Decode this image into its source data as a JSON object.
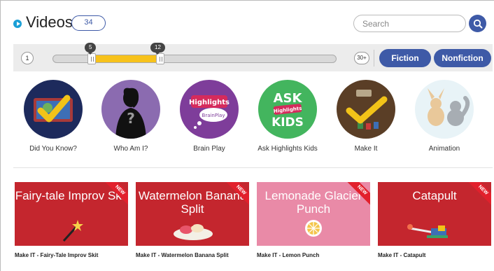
{
  "header": {
    "title": "Videos",
    "count": "34",
    "play_icon": "play-circle-icon"
  },
  "search": {
    "placeholder": "Search",
    "button_icon": "search-icon"
  },
  "filters": {
    "age_min_label": "1",
    "age_max_label": "30+",
    "range_low": "5",
    "range_high": "12",
    "fiction_label": "Fiction",
    "nonfiction_label": "Nonfiction"
  },
  "categories": [
    {
      "label": "Did You Know?",
      "icon": "checkmark-globe-icon"
    },
    {
      "label": "Who Am I?",
      "icon": "silhouette-question-icon"
    },
    {
      "label": "Brain Play",
      "icon": "highlights-brainplay-logo"
    },
    {
      "label": "Ask Highlights Kids",
      "icon": "ask-highlights-kids-logo",
      "logo_text": "ASK",
      "logo_sub": "KIDS",
      "logo_badge": "Highlights"
    },
    {
      "label": "Make It",
      "icon": "craft-checkmark-icon"
    },
    {
      "label": "Animation",
      "icon": "animated-animals-icon"
    }
  ],
  "brainplay_logo": {
    "brand": "Highlights",
    "sub": "BrainPlay"
  },
  "videos": [
    {
      "thumb_title": "Fairy-tale Improv Skit",
      "caption": "Make IT - Fairy-Tale Improv Skit",
      "badge": "NEW"
    },
    {
      "thumb_title": "Watermelon Banana Split",
      "caption": "Make IT - Watermelon Banana Split",
      "badge": "NEW"
    },
    {
      "thumb_title": "Lemonade Glacier Punch",
      "caption": "Make IT - Lemon Punch",
      "badge": "NEW"
    },
    {
      "thumb_title": "Catapult",
      "caption": "Make IT - Catapult",
      "badge": "NEW"
    }
  ],
  "colors": {
    "accent_blue": "#3e5aa7",
    "title_dot": "#1a9fd6",
    "slider_fill": "#f7c21b",
    "card_red": "#c4262e",
    "card_pink": "#e98aa7",
    "ribbon_red": "#e2202c"
  }
}
